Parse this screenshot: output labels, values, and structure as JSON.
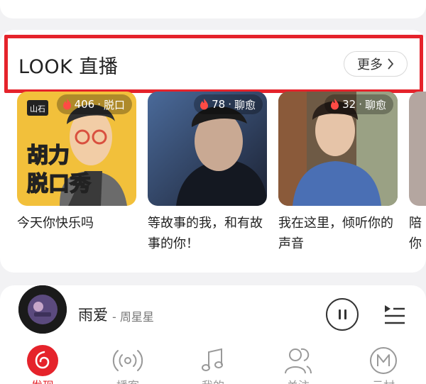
{
  "section": {
    "title": "LOOK 直播",
    "more_label": "更多",
    "highlight_color": "#e5232b"
  },
  "live_items": [
    {
      "count": "406",
      "category": "脱口",
      "title": "今天你快乐吗",
      "cover_text_1": "胡力",
      "cover_text_2": "脱口秀",
      "cover_logo": "山石"
    },
    {
      "count": "78",
      "category": "聊愈",
      "title": "等故事的我，和有故事的你！"
    },
    {
      "count": "32",
      "category": "聊愈",
      "title": "我在这里，倾听你的声音"
    },
    {
      "title": "陪你"
    }
  ],
  "player": {
    "song": "雨爱",
    "artist": "- 周星星",
    "icons": [
      "pause-icon",
      "playlist-icon"
    ]
  },
  "tabs": [
    {
      "label": "发现",
      "icon": "discover-icon",
      "active": true
    },
    {
      "label": "播客",
      "icon": "podcast-icon"
    },
    {
      "label": "我的",
      "icon": "music-note-icon"
    },
    {
      "label": "关注",
      "icon": "follow-icon"
    },
    {
      "label": "云村",
      "icon": "cloud-village-icon"
    }
  ],
  "colors": {
    "accent": "#e5232b",
    "background": "#f2f2f4"
  }
}
